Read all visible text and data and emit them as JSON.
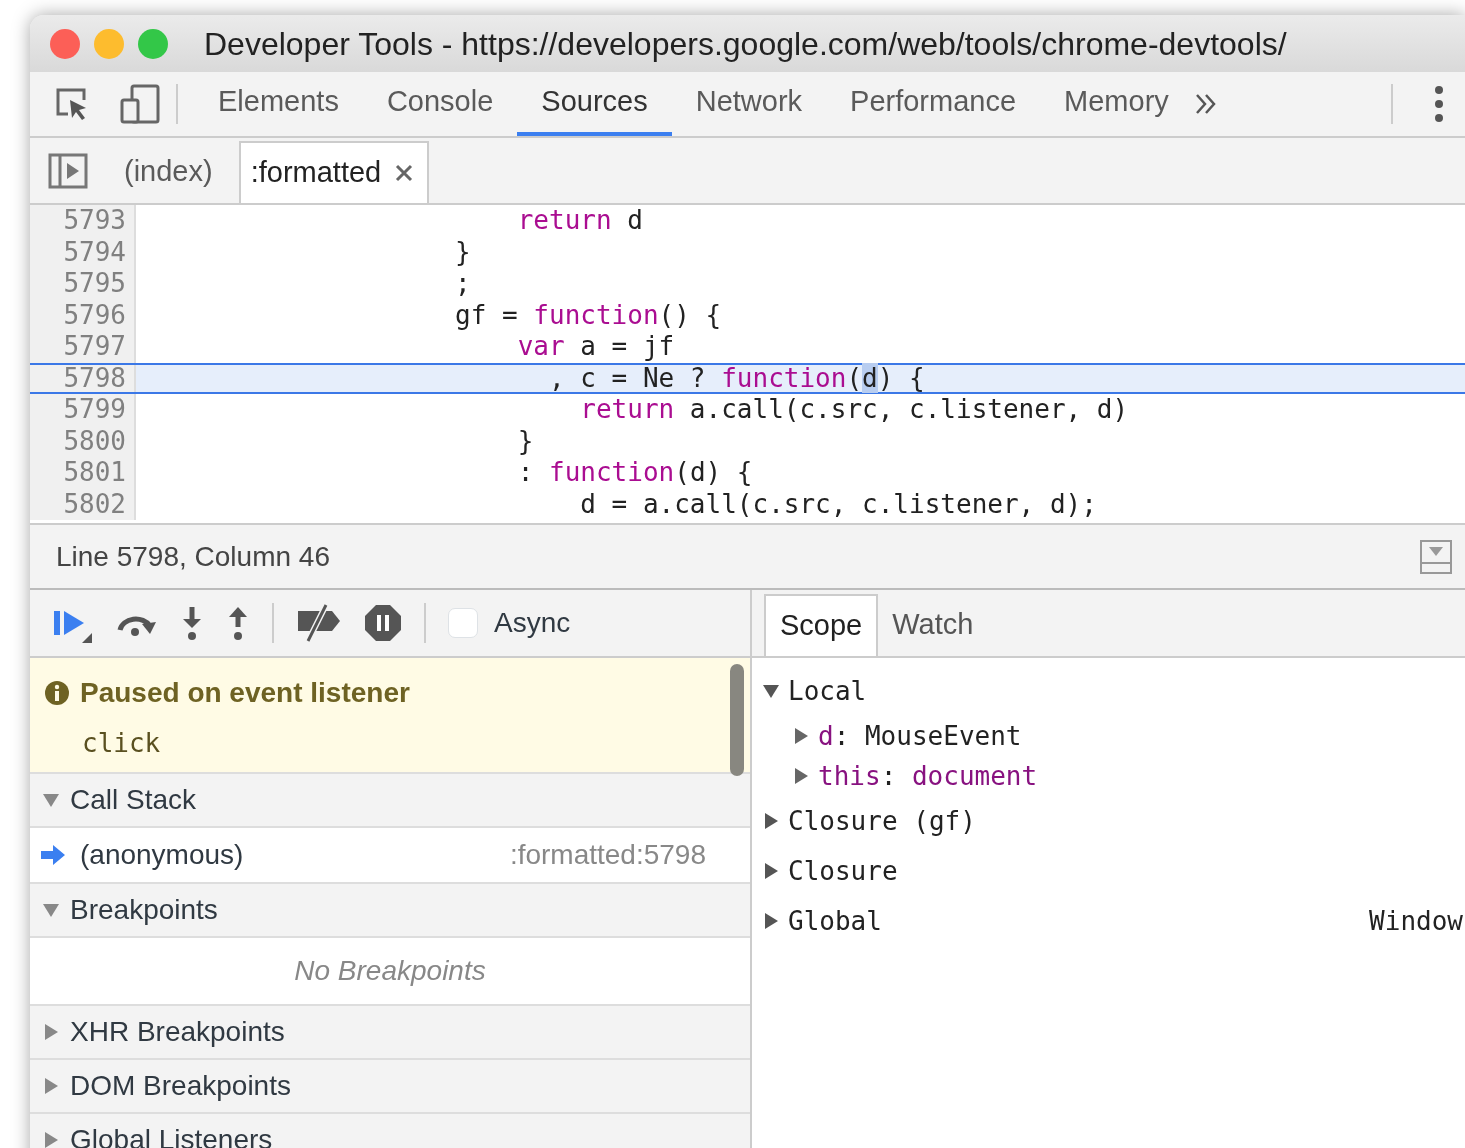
{
  "window": {
    "title": "Developer Tools - https://developers.google.com/web/tools/chrome-devtools/"
  },
  "tabs": [
    {
      "label": "Elements",
      "selected": false
    },
    {
      "label": "Console",
      "selected": false
    },
    {
      "label": "Sources",
      "selected": true
    },
    {
      "label": "Network",
      "selected": false
    },
    {
      "label": "Performance",
      "selected": false
    },
    {
      "label": "Memory",
      "selected": false
    }
  ],
  "file_tabs": [
    {
      "label": "(index)",
      "selected": false,
      "closable": false
    },
    {
      "label": ":formatted",
      "selected": true,
      "closable": true
    }
  ],
  "code": [
    {
      "number": "5793",
      "selected": false,
      "tokens": [
        {
          "text": "                        return",
          "kind": "keyword"
        },
        {
          "text": " d",
          "kind": "plain"
        }
      ]
    },
    {
      "number": "5794",
      "selected": false,
      "tokens": [
        {
          "text": "                    }",
          "kind": "plain"
        }
      ]
    },
    {
      "number": "5795",
      "selected": false,
      "tokens": [
        {
          "text": "                    ;",
          "kind": "plain"
        }
      ]
    },
    {
      "number": "5796",
      "selected": false,
      "tokens": [
        {
          "text": "                    gf = ",
          "kind": "plain"
        },
        {
          "text": "function",
          "kind": "keyword"
        },
        {
          "text": "() {",
          "kind": "plain"
        }
      ]
    },
    {
      "number": "5797",
      "selected": false,
      "tokens": [
        {
          "text": "                        var",
          "kind": "keyword"
        },
        {
          "text": " a = jf",
          "kind": "plain"
        }
      ]
    },
    {
      "number": "5798",
      "selected": true,
      "tokens": [
        {
          "text": "                          , c = Ne ? ",
          "kind": "plain"
        },
        {
          "text": "function",
          "kind": "keyword"
        },
        {
          "text": "(",
          "kind": "plain"
        },
        {
          "text": "d",
          "kind": "hover"
        },
        {
          "text": ") {",
          "kind": "plain"
        }
      ]
    },
    {
      "number": "5799",
      "selected": false,
      "tokens": [
        {
          "text": "                            return",
          "kind": "keyword"
        },
        {
          "text": " a.call(c.src, c.listener, d)",
          "kind": "plain"
        }
      ]
    },
    {
      "number": "5800",
      "selected": false,
      "tokens": [
        {
          "text": "                        }",
          "kind": "plain"
        }
      ]
    },
    {
      "number": "5801",
      "selected": false,
      "tokens": [
        {
          "text": "                        : ",
          "kind": "plain"
        },
        {
          "text": "function",
          "kind": "keyword"
        },
        {
          "text": "(d) {",
          "kind": "plain"
        }
      ]
    },
    {
      "number": "5802",
      "selected": false,
      "tokens": [
        {
          "text": "                            d = a.call(c.src, c.listener, d);",
          "kind": "plain"
        }
      ]
    }
  ],
  "status_bar": {
    "text": "Line 5798, Column 46"
  },
  "debugger": {
    "async": {
      "label": "Async",
      "checked": false
    }
  },
  "paused": {
    "title": "Paused on event listener",
    "detail": "click"
  },
  "sections": [
    {
      "title": "Call Stack",
      "expanded": true,
      "frames": [
        {
          "name": "(anonymous)",
          "location": ":formatted:5798",
          "selected": true
        }
      ]
    },
    {
      "title": "Breakpoints",
      "expanded": true,
      "empty_text": "No Breakpoints"
    },
    {
      "title": "XHR Breakpoints",
      "expanded": false
    },
    {
      "title": "DOM Breakpoints",
      "expanded": false
    },
    {
      "title": "Global Listeners",
      "expanded": false
    }
  ],
  "scope_tabs": [
    {
      "label": "Scope",
      "selected": true
    },
    {
      "label": "Watch",
      "selected": false
    }
  ],
  "scope": [
    {
      "name": "Local",
      "expanded": true,
      "children": [
        {
          "name": "d",
          "separator": ":",
          "value": "MouseEvent",
          "kind": "object",
          "expanded": false
        },
        {
          "name": "this",
          "separator": ":",
          "value": "document",
          "kind": "node",
          "expanded": false
        }
      ]
    },
    {
      "name": "Closure (gf)",
      "expanded": false
    },
    {
      "name": "Closure",
      "expanded": false
    },
    {
      "name": "Global",
      "value": "Window",
      "expanded": false
    }
  ]
}
